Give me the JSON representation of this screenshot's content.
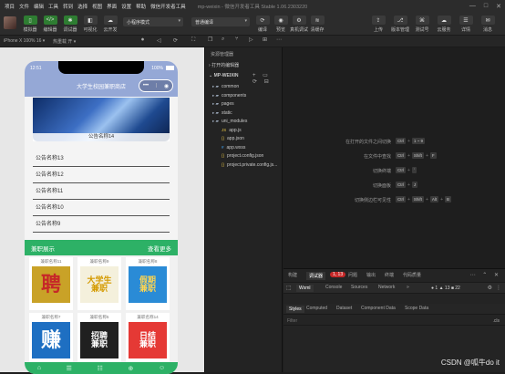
{
  "menubar": {
    "items": [
      "项目",
      "文件",
      "编辑",
      "工具",
      "转到",
      "选择",
      "视图",
      "界面",
      "设置",
      "帮助",
      "微信开发者工具"
    ],
    "window_title": "mp-weixin - 微信开发者工具 Stable 1.06.2303220",
    "window_buttons": [
      "—",
      "□",
      "✕"
    ]
  },
  "toolbar": {
    "left_buttons": [
      {
        "label": "模拟器",
        "icon": "phone-icon",
        "color": "#2e7d32"
      },
      {
        "label": "编辑器",
        "icon": "code-icon",
        "color": "#2e7d32"
      },
      {
        "label": "调试器",
        "icon": "bug-icon",
        "color": "#2e7d32"
      },
      {
        "label": "可视化",
        "icon": "visual-icon",
        "color": "#3b3b3b"
      },
      {
        "label": "云开发",
        "icon": "cloud-icon",
        "color": "#3b3b3b"
      }
    ],
    "mode_select": "小程序模式",
    "compile_select": "普通编译",
    "mid_buttons": [
      {
        "label": "编译",
        "icon": "refresh-icon"
      },
      {
        "label": "预览",
        "icon": "eye-icon"
      },
      {
        "label": "真机调试",
        "icon": "phone-debug-icon"
      },
      {
        "label": "清缓存",
        "icon": "layers-icon"
      }
    ],
    "right_buttons": [
      {
        "label": "上传",
        "icon": "upload-icon"
      },
      {
        "label": "版本管理",
        "icon": "version-icon"
      },
      {
        "label": "测试号",
        "icon": "test-icon"
      },
      {
        "label": "云服务",
        "icon": "cloud-service-icon"
      },
      {
        "label": "详情",
        "icon": "detail-icon"
      },
      {
        "label": "消息",
        "icon": "message-icon"
      }
    ]
  },
  "subbar": {
    "device": "iPhone X 100% 16 ▾",
    "hotreload": "热重载 开 ▾"
  },
  "phone": {
    "time": "12:51",
    "battery": "100%",
    "nav_title": "大学生校园兼职商店",
    "capsule_more": "•••",
    "capsule_close": "◉",
    "banner_caption": "公告名称14",
    "news": [
      "公告名称13",
      "公告名称12",
      "公告名称11",
      "公告名称10",
      "公告名称9"
    ],
    "section_title": "兼职展示",
    "section_more": "查看更多",
    "cards": [
      {
        "title": "兼职名称11",
        "text": "聘",
        "bg": "#c9a227",
        "fg": "#c62828"
      },
      {
        "title": "兼职名称9",
        "text": "大学生\n兼职",
        "bg": "#f4f0dc",
        "fg": "#d49a00"
      },
      {
        "title": "兼职名称8",
        "text": "假期\n兼职",
        "bg": "#2a8bd6",
        "fg": "#ffd54f"
      },
      {
        "title": "兼职名称7",
        "text": "赚",
        "bg": "#1e6fc2",
        "fg": "#ffffff"
      },
      {
        "title": "兼职名称5",
        "text": "招聘\n兼职",
        "bg": "#202020",
        "fg": "#ffffff"
      },
      {
        "title": "兼职名称14",
        "text": "日结\n兼职",
        "bg": "#e53935",
        "fg": "#ffffff"
      }
    ]
  },
  "explorer": {
    "title": "资源管理器",
    "open_editors": "打开的编辑器",
    "project": "MP-WEIXIN",
    "items": [
      {
        "name": "common",
        "type": "folder"
      },
      {
        "name": "components",
        "type": "folder"
      },
      {
        "name": "pages",
        "type": "folder"
      },
      {
        "name": "static",
        "type": "folder"
      },
      {
        "name": "uni_modules",
        "type": "folder"
      },
      {
        "name": "app.js",
        "type": "js"
      },
      {
        "name": "app.json",
        "type": "json"
      },
      {
        "name": "app.wxss",
        "type": "wxss"
      },
      {
        "name": "project.config.json",
        "type": "json"
      },
      {
        "name": "project.private.config.js...",
        "type": "json"
      }
    ]
  },
  "editor": {
    "shortcuts": [
      {
        "label": "在打开的文件之间切换",
        "keys": [
          "Ctrl",
          "1 ~ 9"
        ]
      },
      {
        "label": "在文件中查找",
        "keys": [
          "Ctrl",
          "Shift",
          "F"
        ]
      },
      {
        "label": "切换终端",
        "keys": [
          "Ctrl",
          "`"
        ]
      },
      {
        "label": "切换面板",
        "keys": [
          "Ctrl",
          "J"
        ]
      },
      {
        "label": "切换侧边栏可见性",
        "keys": [
          "Ctrl",
          "Shift",
          "Alt",
          "B"
        ]
      }
    ]
  },
  "devtools": {
    "top_tabs": [
      "构建",
      "调试器",
      "1, 13",
      "问题",
      "输出",
      "终端",
      "代码质量"
    ],
    "panel_tabs": [
      "Wxml",
      "Console",
      "Sources",
      "Network",
      "»"
    ],
    "status": "● 1  ▲ 13  ■ 22",
    "sub_tabs": [
      "Styles",
      "Computed",
      "Dataset",
      "Component Data",
      "Scope Data"
    ],
    "filter_placeholder": "Filter",
    "cls": ".cls"
  },
  "watermark": "CSDN @呱牛do it"
}
